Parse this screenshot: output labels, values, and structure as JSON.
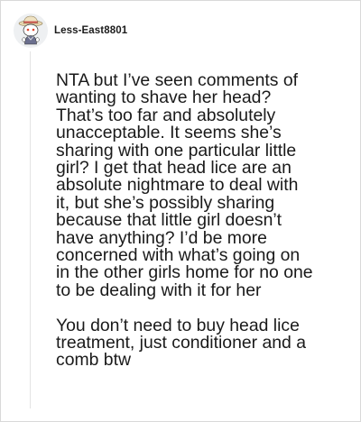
{
  "comment": {
    "author": "Less-East8801",
    "avatar_icon": "reddit-snoo-avatar-icon",
    "paragraphs": [
      "NTA but I’ve seen comments of\nwanting to shave her head?\nThat’s too far and absolutely\nunacceptable. It seems she’s\nsharing with one particular little\ngirl? I get that head lice are an\nabsolute nightmare to deal with\nit, but she’s possibly sharing\nbecause that little girl doesn’t\nhave anything? I’d be more\nconcerned with what’s going on\nin the other girls home for no one\nto be dealing with it for her",
      "You don’t need to buy head lice\ntreatment, just conditioner and a\ncomb btw"
    ]
  },
  "colors": {
    "border": "#d9d9d9",
    "thread_line": "#e3e3e3",
    "text": "#1a1a1a"
  }
}
